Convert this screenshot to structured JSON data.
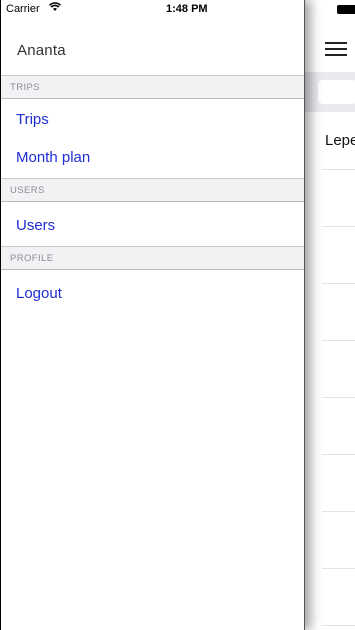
{
  "status_bar": {
    "carrier": "Carrier",
    "wifi_icon": "wifi-icon",
    "time": "1:48 PM",
    "battery_icon": "battery-icon"
  },
  "drawer": {
    "title": "Ananta",
    "sections": [
      {
        "label": "TRIPS",
        "items": [
          "Trips",
          "Month plan"
        ]
      },
      {
        "label": "USERS",
        "items": [
          "Users"
        ]
      },
      {
        "label": "PROFILE",
        "items": [
          "Logout"
        ]
      }
    ]
  },
  "main": {
    "menu_icon": "hamburger-menu-icon",
    "first_row_text": "Lepe"
  },
  "colors": {
    "link": "#1f2dd4",
    "section_bg": "#f2f2f4",
    "section_text": "#8e8e93"
  }
}
